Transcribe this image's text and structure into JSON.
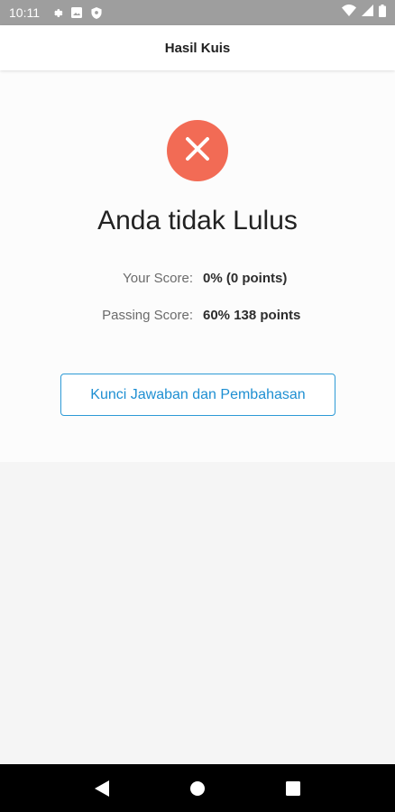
{
  "status_bar": {
    "time": "10:11",
    "left_icons": [
      "gear-icon",
      "image-notification-icon",
      "shield-icon"
    ],
    "right_icons": [
      "wifi-icon",
      "signal-icon",
      "battery-icon"
    ]
  },
  "app_bar": {
    "title": "Hasil Kuis"
  },
  "result": {
    "status_icon": "close-icon",
    "status_color": "#f26b55",
    "title": "Anda tidak Lulus",
    "your_score_label": "Your Score:",
    "your_score_value": "0% (0 points)",
    "passing_score_label": "Passing Score:",
    "passing_score_value": "60% 138 points",
    "button_label": "Kunci Jawaban dan Pembahasan"
  },
  "nav_bar": {
    "buttons": [
      "back-icon",
      "home-icon",
      "recents-icon"
    ]
  }
}
